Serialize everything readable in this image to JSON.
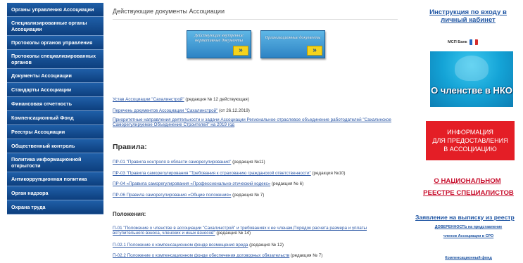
{
  "sidebar": {
    "items": [
      {
        "label": "Органы управления Ассоциации"
      },
      {
        "label": "Специализированные органы Ассоциации"
      },
      {
        "label": "Протоколы органов управления"
      },
      {
        "label": "Протоколы специализированных органов"
      },
      {
        "label": "Документы Ассоциации"
      },
      {
        "label": "Стандарты Ассоциации"
      },
      {
        "label": "Финансовая отчетность"
      },
      {
        "label": "Компенсационный Фонд"
      },
      {
        "label": "Реестры Ассоциации"
      },
      {
        "label": "Общественный контроль"
      },
      {
        "label": "Политика информационной открытости"
      },
      {
        "label": "Антикоррупционная политика"
      },
      {
        "label": "Орган надзора"
      },
      {
        "label": "Охрана труда"
      }
    ]
  },
  "main": {
    "title": "Действующие документы Ассоциации",
    "tiles": [
      {
        "label": "Действующие внутренние нормативные документы"
      },
      {
        "label": "Организационные документы"
      }
    ],
    "docs": [
      {
        "link": "Устав Ассоциации \"Сахалинстрой\"",
        "suffix": " (редакция № 12   действующая)"
      },
      {
        "link": "Перечень документов Ассоциации \"Сахалинстрой\"",
        "suffix": " (от  26.12.2019)"
      },
      {
        "link": "Приоритетные направления деятельности и задачи Ассоциации Региональное отраслевое объединение работодателей \"Сахалинское Саморегулируемое Объединение Строителей\" на 2019 год",
        "suffix": ""
      }
    ],
    "rules_title": "Правила:",
    "rules": [
      {
        "link": "ПР-01 \"Правила контроля в области саморегулирования\"",
        "suffix": " (редакция №11)"
      },
      {
        "link": "ПР-03 \"Правила саморегулирования \"Требования к страхованию гражданской ответственности\"",
        "suffix": " (редакция №10)"
      },
      {
        "link": "ПР-04 «Правила саморегулирования «Профессионально-этический кодекс»",
        "suffix": " (редакция № 6)"
      },
      {
        "link": "ПР-06 Правила саморегулирования «Общие положения»",
        "suffix": " (редакция № 7)"
      }
    ],
    "positions_title": "Положения:",
    "positions": [
      {
        "link": "П-01 \"Положение о членстве в ассоциации \"Сахалинстрой\" и требованиях к ее членам,Порядок расчета размера и уплаты вступительного взноса, членских и иных взносов\"",
        "suffix": " (редакция № 14)"
      },
      {
        "link": "П-02.1 Положение о компенсационном фонде возмещения вреда",
        "suffix": "  (редакция № 12)"
      },
      {
        "link": "П-02.2 Положение о компенсационном фонде обеспечения договорных обязательств",
        "suffix": " (редакция № 7)"
      }
    ]
  },
  "right": {
    "instruction": "Инструкция по входу в личный кабинет",
    "msp": "МСП Банк",
    "nko": "О членстве в НКО",
    "red_banner": [
      "ИНФОРМАЦИЯ",
      "ДЛЯ ПРЕДОСТАВЛЕНИЯ",
      "В АССОЦИАЦИЮ"
    ],
    "national_registry_1": "О НАЦИОНАЛЬНОМ",
    "national_registry_2": "РЕЕСТРЕ СПЕЦИАЛИСТОВ",
    "vypiska": "Заявление на выписку из реестр",
    "doverennost_1": "ДОВЕРЕННОСТЬ на представление",
    "doverennost_2": "членов Ассоциации в СРО",
    "komp_fond": "Компенсационный фонд"
  },
  "colors": {
    "sidebar_bg": "#0d3f7e",
    "link": "#2a56a5",
    "accent_red": "#e41e26",
    "national_registry": "#c8102e"
  }
}
